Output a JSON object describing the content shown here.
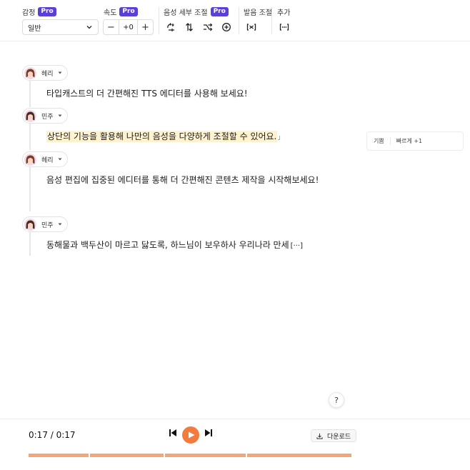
{
  "toolbar": {
    "emotion": {
      "label": "감정",
      "badge": "Pro",
      "value": "일반"
    },
    "speed": {
      "label": "속도",
      "badge": "Pro",
      "value": "+0",
      "minus": "−",
      "plus": "+"
    },
    "voice_detail": {
      "label": "음성 세부 조절",
      "badge": "Pro"
    },
    "pronunciation": {
      "label": "발음 조절"
    },
    "more": {
      "label": "추가"
    },
    "icons": [
      "pitch-adjust-icon",
      "swap-vertical-icon",
      "shuffle-icon",
      "add-circle-icon",
      "pronunciation-bracket-icon",
      "ellipsis-bracket-icon"
    ]
  },
  "script": {
    "lines": [
      {
        "speaker": "헤리",
        "text": "타입캐스트의 더 간편해진 TTS 에디터를 사용해 보세요!",
        "highlighted": false
      },
      {
        "speaker": "민주",
        "text": "상단의 기능을 활용해 나만의 음성을 다양하게 조절할 수 있어요.",
        "highlighted": true
      },
      {
        "speaker": "헤리",
        "text": "음성 편집에 집중된 에디터를 통해 더 간편해진 콘텐츠 제작을 시작해보세요!",
        "highlighted": false
      },
      {
        "speaker": "민주",
        "text": "동해물과 백두산이 마르고 닳도록, 하느님이 보우하사 우리나라 만세",
        "ellipsis": "[···]",
        "highlighted": false
      }
    ]
  },
  "line_tags": {
    "emotion": "기쁨",
    "speed": "빠르게 +1"
  },
  "help": {
    "label": "?"
  },
  "player": {
    "time": "0:17 / 0:17",
    "download_label": "다운로드",
    "progress": 1.0
  },
  "colors": {
    "pro_badge": "#5b3fd6",
    "play_button": "#f47b3f",
    "progress": "#f5a676",
    "highlight": "#fff3cf"
  }
}
